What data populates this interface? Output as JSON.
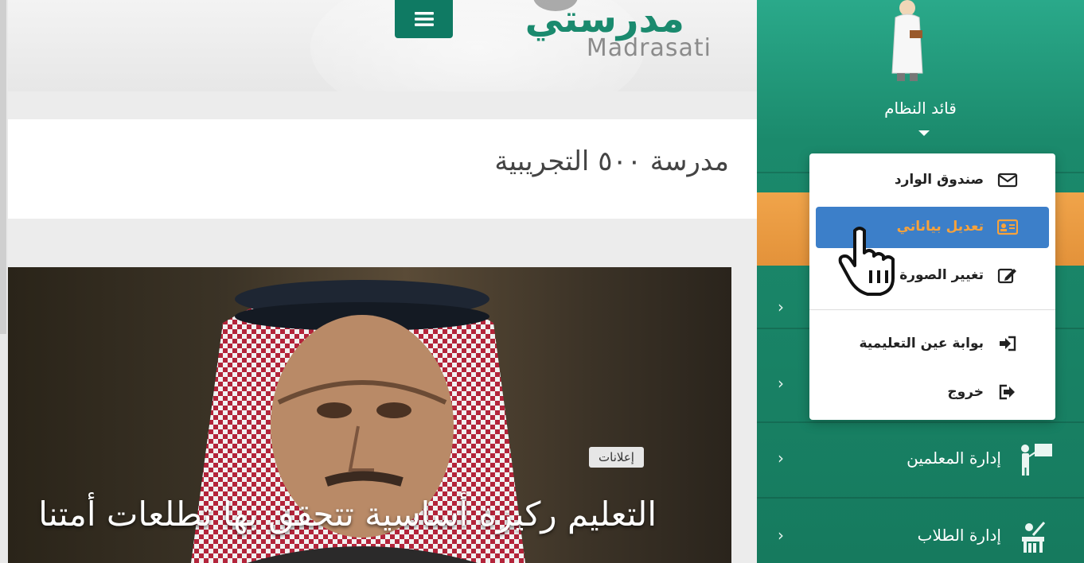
{
  "header": {
    "logo_ar": "مدرستي",
    "logo_en": "Madrasati",
    "menu_icon": "hamburger-icon"
  },
  "school": {
    "title": "مدرسة ٥٠٠ التجريبية"
  },
  "hero": {
    "tag": "إعلانات",
    "headline": "التعليم ركيزة أساسية تتحقق بها تطلعات أمتنا"
  },
  "sidebar": {
    "user_name": "قائد النظام",
    "items": [
      {
        "label": "",
        "icon": "chevron-left-icon"
      },
      {
        "label": "",
        "icon": "chevron-left-icon"
      },
      {
        "label": "إدارة المعلمين",
        "icon": "teacher-icon"
      },
      {
        "label": "إدارة الطلاب",
        "icon": "students-icon"
      }
    ]
  },
  "dropdown": {
    "items": [
      {
        "label": "صندوق الوارد",
        "icon": "envelope-icon"
      },
      {
        "label": "تعديل بياناتي",
        "icon": "id-card-icon",
        "active": true
      },
      {
        "label": "تغيير الصورة",
        "icon": "edit-icon"
      },
      {
        "label": "بوابة عين التعليمية",
        "icon": "sign-in-icon"
      },
      {
        "label": "خروج",
        "icon": "sign-out-icon"
      }
    ]
  },
  "colors": {
    "brand_green": "#0f7a63",
    "active_blue": "#3c7fc9",
    "active_text": "#f7a23b"
  }
}
